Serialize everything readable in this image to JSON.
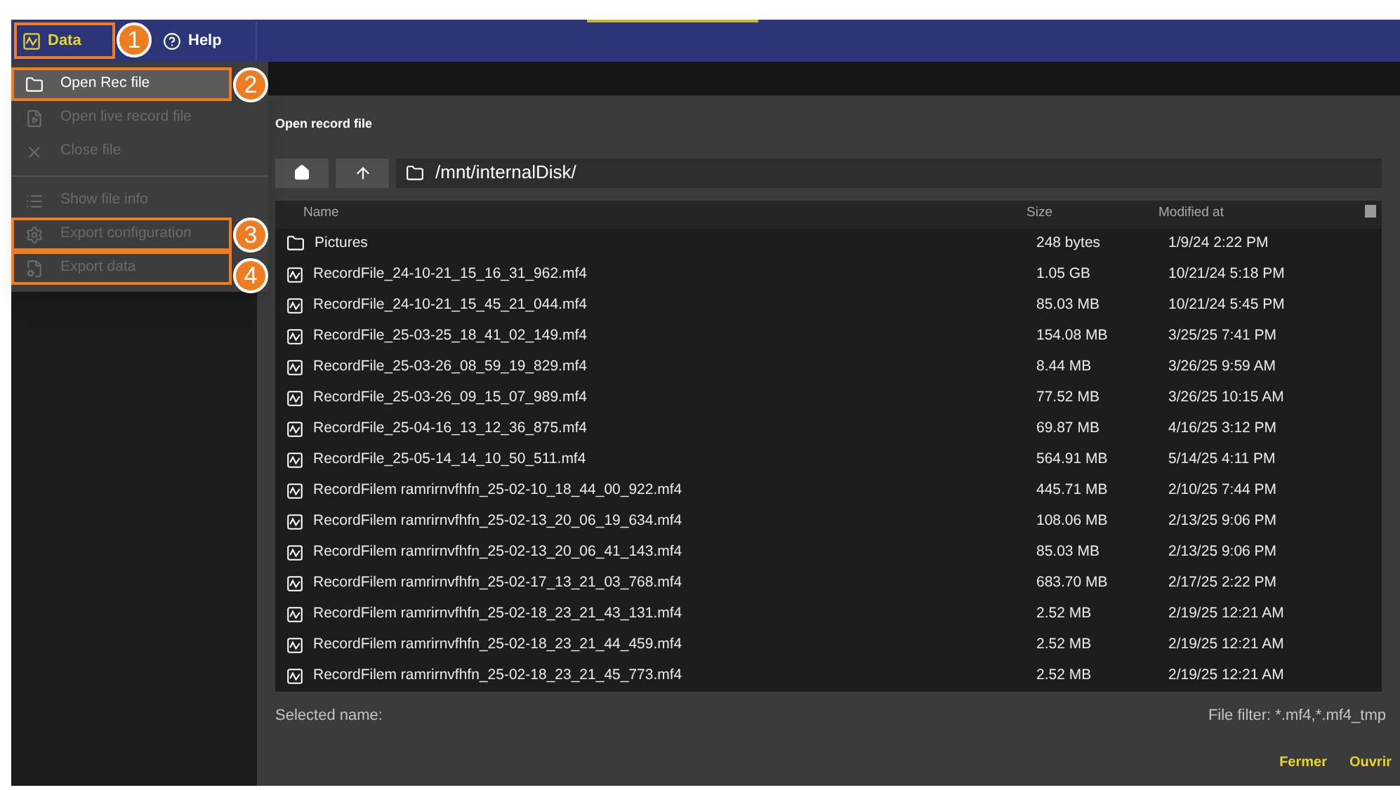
{
  "menubar": [
    {
      "label": "Data",
      "selected": true,
      "callout": "1"
    },
    {
      "label": "Help",
      "selected": false
    }
  ],
  "menu": {
    "groups": [
      [
        {
          "label": "Open Rec file",
          "disabled": false,
          "selected": true,
          "callout": "2"
        },
        {
          "label": "Open live record file",
          "disabled": true,
          "selected": false
        },
        {
          "label": "Close file",
          "disabled": true,
          "selected": false
        }
      ],
      [
        {
          "label": "Show file info",
          "disabled": true,
          "selected": false
        },
        {
          "label": "Export configuration",
          "disabled": true,
          "selected": false,
          "callout": "3"
        },
        {
          "label": "Export data",
          "disabled": true,
          "selected": false,
          "callout": "4"
        }
      ]
    ]
  },
  "dialog": {
    "title": "Open record file",
    "path": "/mnt/internalDisk/",
    "table": {
      "columns": [
        "Name",
        "Size",
        "Modified at"
      ],
      "rows": [
        {
          "kind": "folder",
          "name": "Pictures",
          "size": "248 bytes",
          "modified": "1/9/24 2:22 PM"
        },
        {
          "kind": "record",
          "name": "RecordFile_24-10-21_15_16_31_962.mf4",
          "size": "1.05 GB",
          "modified": "10/21/24 5:18 PM"
        },
        {
          "kind": "record",
          "name": "RecordFile_24-10-21_15_45_21_044.mf4",
          "size": "85.03 MB",
          "modified": "10/21/24 5:45 PM"
        },
        {
          "kind": "record",
          "name": "RecordFile_25-03-25_18_41_02_149.mf4",
          "size": "154.08 MB",
          "modified": "3/25/25 7:41 PM"
        },
        {
          "kind": "record",
          "name": "RecordFile_25-03-26_08_59_19_829.mf4",
          "size": "8.44 MB",
          "modified": "3/26/25 9:59 AM"
        },
        {
          "kind": "record",
          "name": "RecordFile_25-03-26_09_15_07_989.mf4",
          "size": "77.52 MB",
          "modified": "3/26/25 10:15 AM"
        },
        {
          "kind": "record",
          "name": "RecordFile_25-04-16_13_12_36_875.mf4",
          "size": "69.87 MB",
          "modified": "4/16/25 3:12 PM"
        },
        {
          "kind": "record",
          "name": "RecordFile_25-05-14_14_10_50_511.mf4",
          "size": "564.91 MB",
          "modified": "5/14/25 4:11 PM"
        },
        {
          "kind": "record",
          "name": "RecordFilem ramrirnvfhfn_25-02-10_18_44_00_922.mf4",
          "size": "445.71 MB",
          "modified": "2/10/25 7:44 PM"
        },
        {
          "kind": "record",
          "name": "RecordFilem ramrirnvfhfn_25-02-13_20_06_19_634.mf4",
          "size": "108.06 MB",
          "modified": "2/13/25 9:06 PM"
        },
        {
          "kind": "record",
          "name": "RecordFilem ramrirnvfhfn_25-02-13_20_06_41_143.mf4",
          "size": "85.03 MB",
          "modified": "2/13/25 9:06 PM"
        },
        {
          "kind": "record",
          "name": "RecordFilem ramrirnvfhfn_25-02-17_13_21_03_768.mf4",
          "size": "683.70 MB",
          "modified": "2/17/25 2:22 PM"
        },
        {
          "kind": "record",
          "name": "RecordFilem ramrirnvfhfn_25-02-18_23_21_43_131.mf4",
          "size": "2.52 MB",
          "modified": "2/19/25 12:21 AM"
        },
        {
          "kind": "record",
          "name": "RecordFilem ramrirnvfhfn_25-02-18_23_21_44_459.mf4",
          "size": "2.52 MB",
          "modified": "2/19/25 12:21 AM"
        },
        {
          "kind": "record",
          "name": "RecordFilem ramrirnvfhfn_25-02-18_23_21_45_773.mf4",
          "size": "2.52 MB",
          "modified": "2/19/25 12:21 AM"
        }
      ]
    },
    "selected_name_label": "Selected name:",
    "file_filter": "File filter: *.mf4,*.mf4_tmp",
    "buttons": [
      "Fermer",
      "Ouvrir"
    ]
  }
}
